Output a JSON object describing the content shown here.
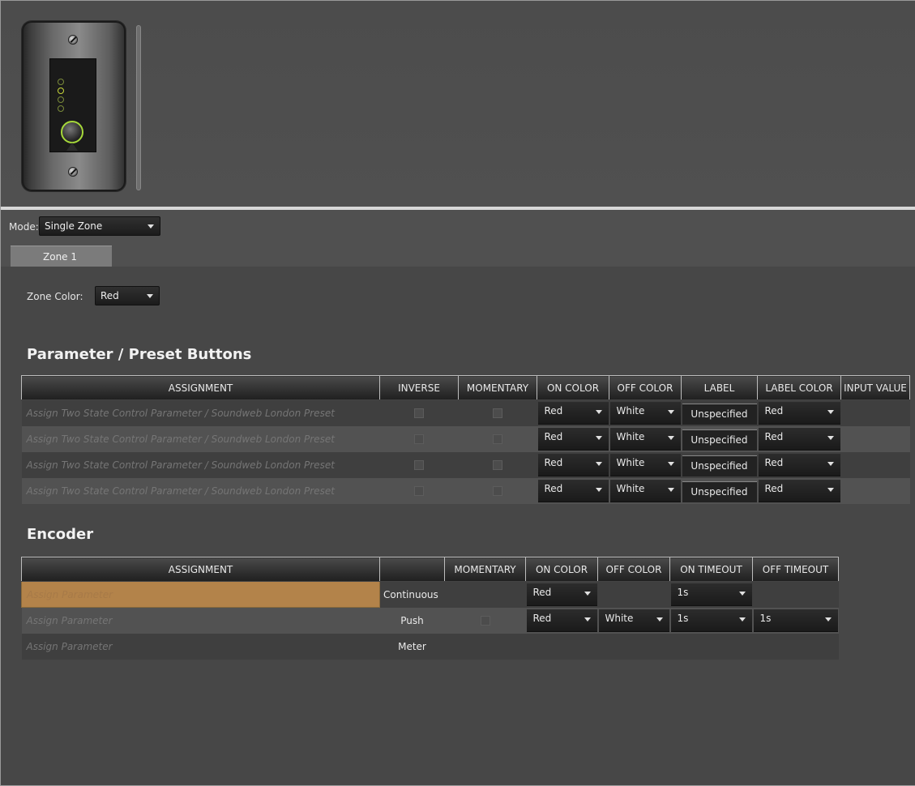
{
  "mode": {
    "label": "Mode:",
    "value": "Single Zone"
  },
  "tabs": [
    {
      "label": "Zone 1"
    }
  ],
  "zone_color": {
    "label": "Zone Color:",
    "value": "Red"
  },
  "buttons_section": {
    "heading": "Parameter / Preset Buttons",
    "headers": [
      "ASSIGNMENT",
      "INVERSE",
      "MOMENTARY",
      "ON COLOR",
      "OFF COLOR",
      "LABEL",
      "LABEL COLOR",
      "INPUT VALUE"
    ],
    "rows": [
      {
        "assignment": "Assign Two State Control Parameter / Soundweb London Preset",
        "on_color": "Red",
        "off_color": "White",
        "label": "Unspecified",
        "label_color": "Red"
      },
      {
        "assignment": "Assign Two State Control Parameter / Soundweb London Preset",
        "on_color": "Red",
        "off_color": "White",
        "label": "Unspecified",
        "label_color": "Red"
      },
      {
        "assignment": "Assign Two State Control Parameter / Soundweb London Preset",
        "on_color": "Red",
        "off_color": "White",
        "label": "Unspecified",
        "label_color": "Red"
      },
      {
        "assignment": "Assign Two State Control Parameter / Soundweb London Preset",
        "on_color": "Red",
        "off_color": "White",
        "label": "Unspecified",
        "label_color": "Red"
      }
    ]
  },
  "encoder_section": {
    "heading": "Encoder",
    "headers": [
      "ASSIGNMENT",
      "",
      "MOMENTARY",
      "ON COLOR",
      "OFF COLOR",
      "ON TIMEOUT",
      "OFF TIMEOUT"
    ],
    "rows": [
      {
        "assignment": "Assign Parameter",
        "mode": "Continuous",
        "on_color": "Red",
        "on_timeout": "1s"
      },
      {
        "assignment": "Assign Parameter",
        "mode": "Push",
        "on_color": "Red",
        "off_color": "White",
        "on_timeout": "1s",
        "off_timeout": "1s"
      },
      {
        "assignment": "Assign Parameter",
        "mode": "Meter"
      }
    ]
  },
  "colors": {
    "background": "#474747",
    "highlight": "#b3834a",
    "led_green": "#a6d83a"
  }
}
